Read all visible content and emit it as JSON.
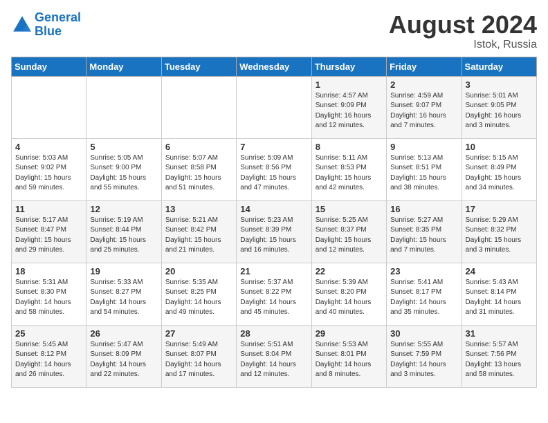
{
  "logo": {
    "line1": "General",
    "line2": "Blue"
  },
  "title": "August 2024",
  "location": "Istok, Russia",
  "days_header": [
    "Sunday",
    "Monday",
    "Tuesday",
    "Wednesday",
    "Thursday",
    "Friday",
    "Saturday"
  ],
  "weeks": [
    [
      {
        "day": "",
        "info": ""
      },
      {
        "day": "",
        "info": ""
      },
      {
        "day": "",
        "info": ""
      },
      {
        "day": "",
        "info": ""
      },
      {
        "day": "1",
        "info": "Sunrise: 4:57 AM\nSunset: 9:09 PM\nDaylight: 16 hours\nand 12 minutes."
      },
      {
        "day": "2",
        "info": "Sunrise: 4:59 AM\nSunset: 9:07 PM\nDaylight: 16 hours\nand 7 minutes."
      },
      {
        "day": "3",
        "info": "Sunrise: 5:01 AM\nSunset: 9:05 PM\nDaylight: 16 hours\nand 3 minutes."
      }
    ],
    [
      {
        "day": "4",
        "info": "Sunrise: 5:03 AM\nSunset: 9:02 PM\nDaylight: 15 hours\nand 59 minutes."
      },
      {
        "day": "5",
        "info": "Sunrise: 5:05 AM\nSunset: 9:00 PM\nDaylight: 15 hours\nand 55 minutes."
      },
      {
        "day": "6",
        "info": "Sunrise: 5:07 AM\nSunset: 8:58 PM\nDaylight: 15 hours\nand 51 minutes."
      },
      {
        "day": "7",
        "info": "Sunrise: 5:09 AM\nSunset: 8:56 PM\nDaylight: 15 hours\nand 47 minutes."
      },
      {
        "day": "8",
        "info": "Sunrise: 5:11 AM\nSunset: 8:53 PM\nDaylight: 15 hours\nand 42 minutes."
      },
      {
        "day": "9",
        "info": "Sunrise: 5:13 AM\nSunset: 8:51 PM\nDaylight: 15 hours\nand 38 minutes."
      },
      {
        "day": "10",
        "info": "Sunrise: 5:15 AM\nSunset: 8:49 PM\nDaylight: 15 hours\nand 34 minutes."
      }
    ],
    [
      {
        "day": "11",
        "info": "Sunrise: 5:17 AM\nSunset: 8:47 PM\nDaylight: 15 hours\nand 29 minutes."
      },
      {
        "day": "12",
        "info": "Sunrise: 5:19 AM\nSunset: 8:44 PM\nDaylight: 15 hours\nand 25 minutes."
      },
      {
        "day": "13",
        "info": "Sunrise: 5:21 AM\nSunset: 8:42 PM\nDaylight: 15 hours\nand 21 minutes."
      },
      {
        "day": "14",
        "info": "Sunrise: 5:23 AM\nSunset: 8:39 PM\nDaylight: 15 hours\nand 16 minutes."
      },
      {
        "day": "15",
        "info": "Sunrise: 5:25 AM\nSunset: 8:37 PM\nDaylight: 15 hours\nand 12 minutes."
      },
      {
        "day": "16",
        "info": "Sunrise: 5:27 AM\nSunset: 8:35 PM\nDaylight: 15 hours\nand 7 minutes."
      },
      {
        "day": "17",
        "info": "Sunrise: 5:29 AM\nSunset: 8:32 PM\nDaylight: 15 hours\nand 3 minutes."
      }
    ],
    [
      {
        "day": "18",
        "info": "Sunrise: 5:31 AM\nSunset: 8:30 PM\nDaylight: 14 hours\nand 58 minutes."
      },
      {
        "day": "19",
        "info": "Sunrise: 5:33 AM\nSunset: 8:27 PM\nDaylight: 14 hours\nand 54 minutes."
      },
      {
        "day": "20",
        "info": "Sunrise: 5:35 AM\nSunset: 8:25 PM\nDaylight: 14 hours\nand 49 minutes."
      },
      {
        "day": "21",
        "info": "Sunrise: 5:37 AM\nSunset: 8:22 PM\nDaylight: 14 hours\nand 45 minutes."
      },
      {
        "day": "22",
        "info": "Sunrise: 5:39 AM\nSunset: 8:20 PM\nDaylight: 14 hours\nand 40 minutes."
      },
      {
        "day": "23",
        "info": "Sunrise: 5:41 AM\nSunset: 8:17 PM\nDaylight: 14 hours\nand 35 minutes."
      },
      {
        "day": "24",
        "info": "Sunrise: 5:43 AM\nSunset: 8:14 PM\nDaylight: 14 hours\nand 31 minutes."
      }
    ],
    [
      {
        "day": "25",
        "info": "Sunrise: 5:45 AM\nSunset: 8:12 PM\nDaylight: 14 hours\nand 26 minutes."
      },
      {
        "day": "26",
        "info": "Sunrise: 5:47 AM\nSunset: 8:09 PM\nDaylight: 14 hours\nand 22 minutes."
      },
      {
        "day": "27",
        "info": "Sunrise: 5:49 AM\nSunset: 8:07 PM\nDaylight: 14 hours\nand 17 minutes."
      },
      {
        "day": "28",
        "info": "Sunrise: 5:51 AM\nSunset: 8:04 PM\nDaylight: 14 hours\nand 12 minutes."
      },
      {
        "day": "29",
        "info": "Sunrise: 5:53 AM\nSunset: 8:01 PM\nDaylight: 14 hours\nand 8 minutes."
      },
      {
        "day": "30",
        "info": "Sunrise: 5:55 AM\nSunset: 7:59 PM\nDaylight: 14 hours\nand 3 minutes."
      },
      {
        "day": "31",
        "info": "Sunrise: 5:57 AM\nSunset: 7:56 PM\nDaylight: 13 hours\nand 58 minutes."
      }
    ]
  ]
}
